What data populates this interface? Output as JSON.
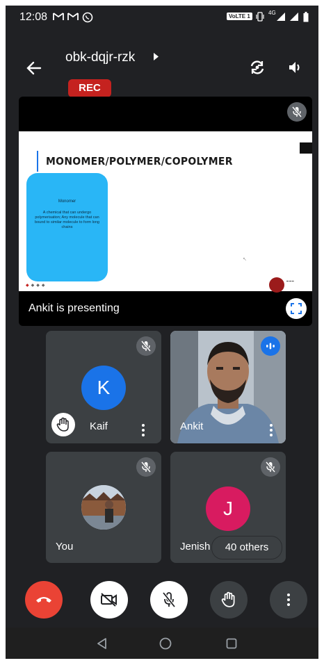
{
  "status_bar": {
    "time": "12:08",
    "volte": "VoLTE 1",
    "network": "4G"
  },
  "header": {
    "meeting_code": "obk-dqjr-rzk",
    "rec_label": "REC"
  },
  "presentation": {
    "slide_title": "MONOMER/POLYMER/COPOLYMER",
    "card_heading": "Monomer",
    "card_body": "A chemical that can undergo polymerisation; Any molecule that can bound to similar molecule to form long chains",
    "caption": "Ankit is presenting"
  },
  "participants": [
    {
      "name": "Kaif",
      "initial": "K",
      "muted": true,
      "hand_raised": true,
      "avatar_color": "#1a73e8"
    },
    {
      "name": "Ankit",
      "muted": false,
      "speaking": true
    },
    {
      "name": "You",
      "muted": true
    },
    {
      "name": "Jenish",
      "initial": "J",
      "muted": true,
      "avatar_color": "#d81b60"
    }
  ],
  "others_label": "40 others",
  "controls": {
    "end_call_color": "#ea4335",
    "icons": [
      "end-call-icon",
      "camera-off-icon",
      "mic-off-icon",
      "raise-hand-icon",
      "more-vertical-icon"
    ]
  },
  "colors": {
    "background": "#202124",
    "tile": "#3c4043",
    "rec": "#c5221f",
    "accent_blue": "#1a73e8"
  }
}
